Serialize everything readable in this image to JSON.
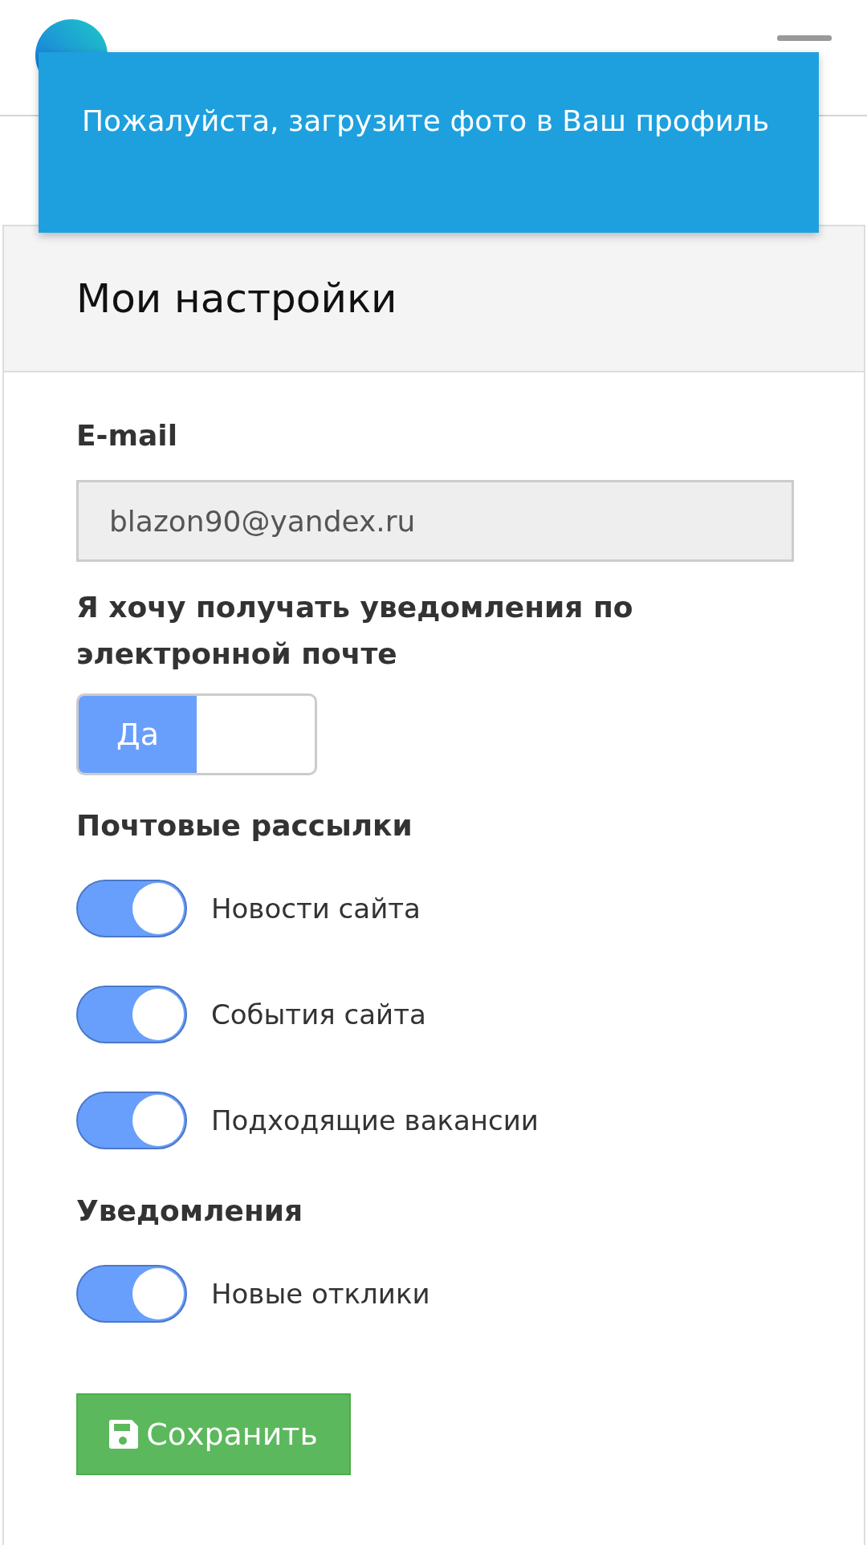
{
  "toast": {
    "message": "Пожалуйста, загрузите фото в Ваш профиль"
  },
  "settings": {
    "title": "Мои настройки",
    "email": {
      "label": "E-mail",
      "value": "blazon90@yandex.ru",
      "disabled": true
    },
    "email_notifications": {
      "label": "Я хочу получать уведомления по электронной почте",
      "toggle_text": "Да",
      "on": true
    },
    "sections": [
      {
        "title": "Почтовые рассылки",
        "items": [
          {
            "label": "Новости сайта",
            "on": true
          },
          {
            "label": "События сайта",
            "on": true
          },
          {
            "label": "Подходящие вакансии",
            "on": true
          }
        ]
      },
      {
        "title": "Уведомления",
        "items": [
          {
            "label": "Новые отклики",
            "on": true
          }
        ]
      }
    ],
    "save_button": "Сохранить"
  }
}
